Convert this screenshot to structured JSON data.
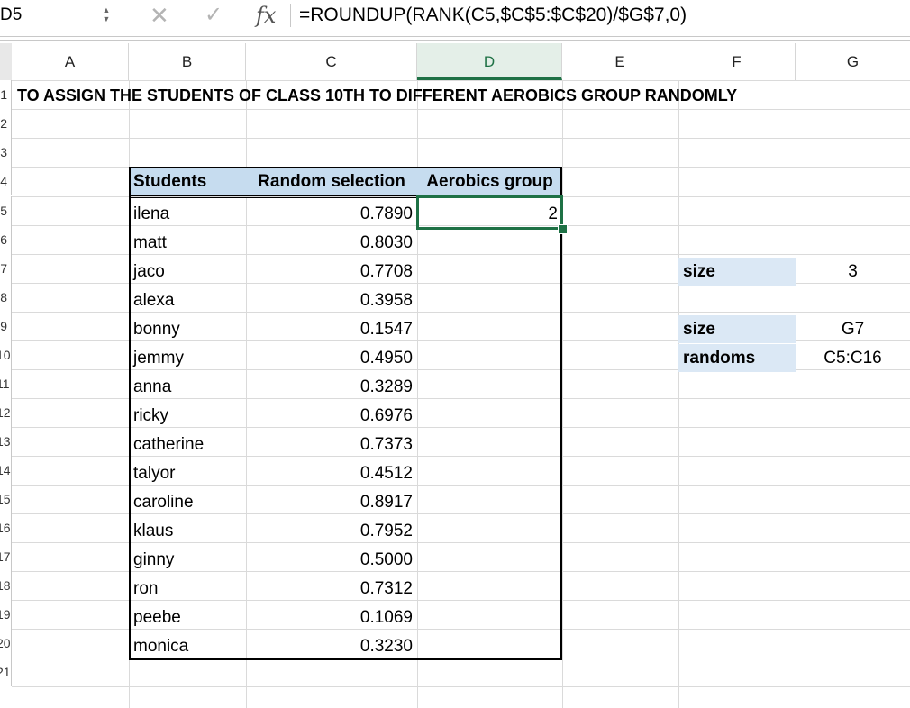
{
  "formula_bar": {
    "name_box": "D5",
    "cancel_icon": "✕",
    "confirm_icon": "✓",
    "fx_label": "fx",
    "formula": "=ROUNDUP(RANK(C5,$C$5:$C$20)/$G$7,0)"
  },
  "columns": [
    "A",
    "B",
    "C",
    "D",
    "E",
    "F",
    "G"
  ],
  "active_column": "D",
  "row_numbers": [
    "1",
    "2",
    "3",
    "4",
    "5",
    "6",
    "7",
    "8",
    "9",
    "10",
    "11",
    "12",
    "13",
    "14",
    "15",
    "16",
    "17",
    "18",
    "19",
    "20",
    "21"
  ],
  "title": "TO ASSIGN THE STUDENTS OF CLASS 10TH TO DIFFERENT AEROBICS GROUP RANDOMLY",
  "table": {
    "headers": [
      "Students",
      "Random selection",
      "Aerobics group"
    ],
    "rows": [
      {
        "student": "ilena",
        "random": "0.7890",
        "group": "2"
      },
      {
        "student": "matt",
        "random": "0.8030",
        "group": ""
      },
      {
        "student": "jaco",
        "random": "0.7708",
        "group": ""
      },
      {
        "student": "alexa",
        "random": "0.3958",
        "group": ""
      },
      {
        "student": "bonny",
        "random": "0.1547",
        "group": ""
      },
      {
        "student": "jemmy",
        "random": "0.4950",
        "group": ""
      },
      {
        "student": "anna",
        "random": "0.3289",
        "group": ""
      },
      {
        "student": "ricky",
        "random": "0.6976",
        "group": ""
      },
      {
        "student": "catherine",
        "random": "0.7373",
        "group": ""
      },
      {
        "student": "talyor",
        "random": "0.4512",
        "group": ""
      },
      {
        "student": "caroline",
        "random": "0.8917",
        "group": ""
      },
      {
        "student": "klaus",
        "random": "0.7952",
        "group": ""
      },
      {
        "student": "ginny",
        "random": "0.5000",
        "group": ""
      },
      {
        "student": "ron",
        "random": "0.7312",
        "group": ""
      },
      {
        "student": "peebe",
        "random": "0.1069",
        "group": ""
      },
      {
        "student": "monica",
        "random": "0.3230",
        "group": ""
      }
    ]
  },
  "side_panel": {
    "size_label": "size",
    "size_value": "3",
    "names": [
      {
        "label": "size",
        "value": "G7"
      },
      {
        "label": "randoms",
        "value": "C5:C16"
      }
    ]
  },
  "colors": {
    "accent_green": "#1e7145",
    "header_blue": "#c6dcef",
    "label_blue": "#dbe8f5"
  }
}
